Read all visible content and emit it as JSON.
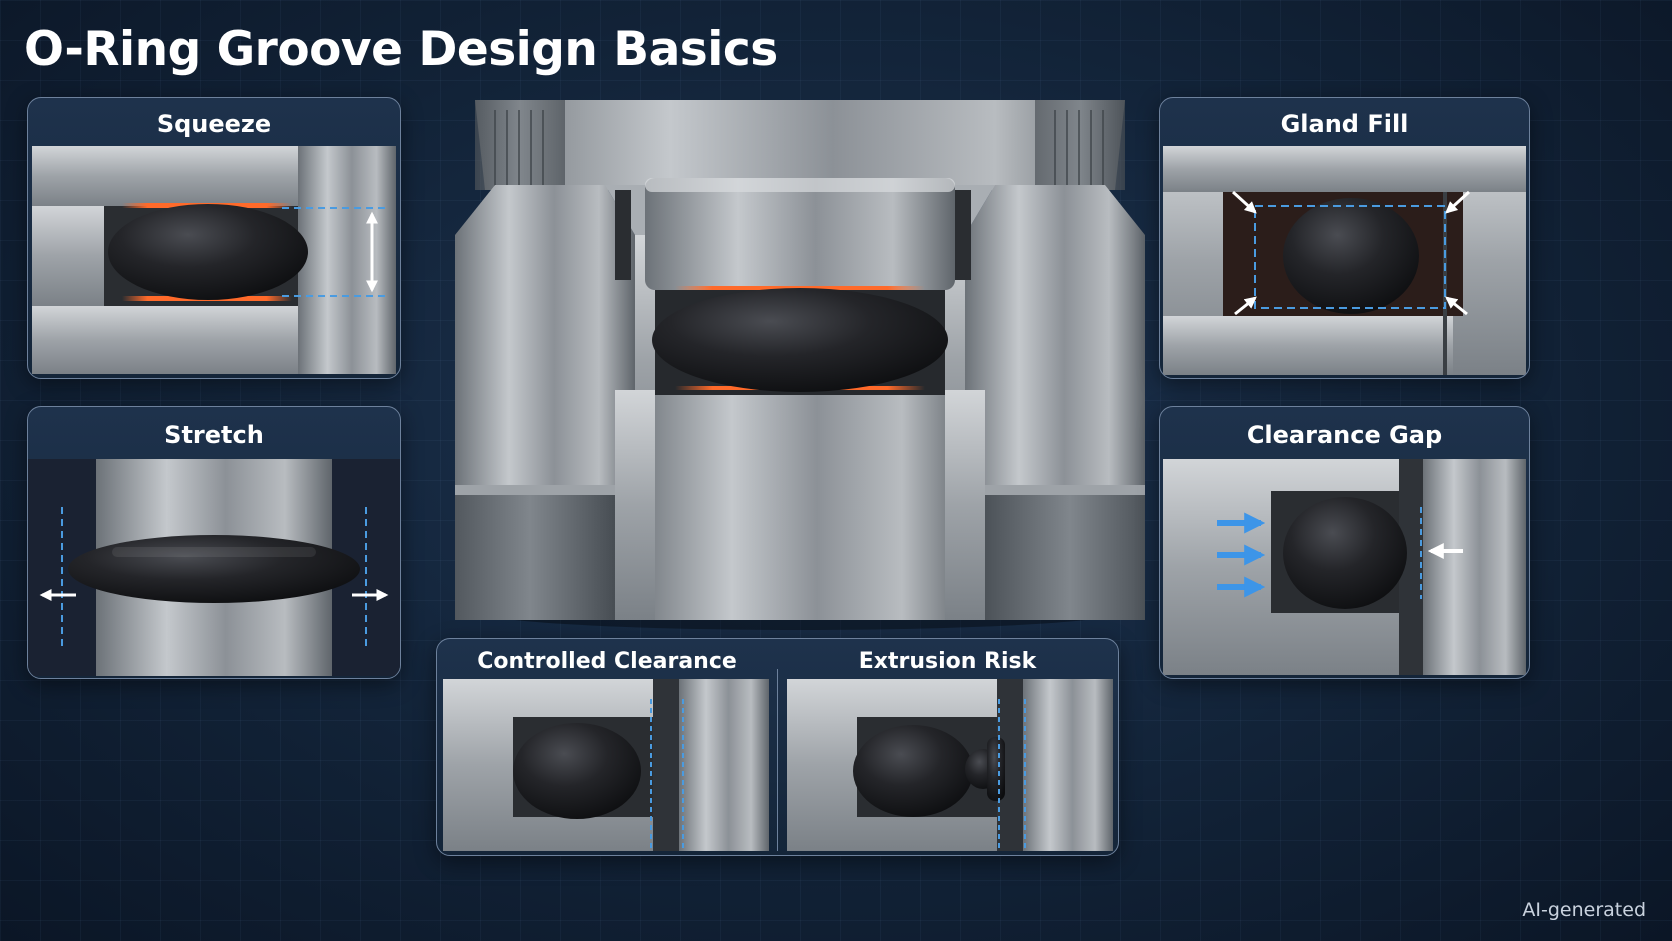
{
  "title": "O-Ring Groove Design Basics",
  "panels": {
    "squeeze": {
      "title": "Squeeze"
    },
    "stretch": {
      "title": "Stretch"
    },
    "gland_fill": {
      "title": "Gland Fill"
    },
    "clearance_gap": {
      "title": "Clearance Gap"
    },
    "controlled_clearance": {
      "title": "Controlled Clearance"
    },
    "extrusion_risk": {
      "title": "Extrusion Risk"
    }
  },
  "watermark": "AI-generated",
  "colors": {
    "background": "#132740",
    "metal": "#9ea3a8",
    "oring": "#1c1d20",
    "guide_dash": "#4a9be0",
    "glow": "#ff6a2a",
    "arrow_blue": "#3d95e8",
    "arrow_white": "#ffffff"
  }
}
